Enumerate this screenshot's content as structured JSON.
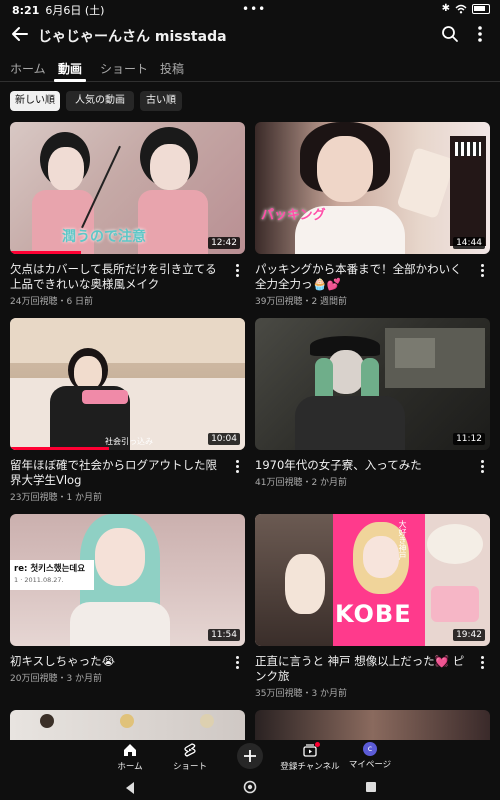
{
  "status_bar": {
    "time": "8:21",
    "date": "6月6日 (土)",
    "dots": "•••"
  },
  "header": {
    "channel_title": "じゃじゃーんさん misstada"
  },
  "tabs": [
    {
      "label": "ホーム"
    },
    {
      "label": "動画",
      "active": true
    },
    {
      "label": "ショート"
    },
    {
      "label": "投稿"
    }
  ],
  "chips": [
    {
      "label": "新しい順",
      "active": true
    },
    {
      "label": "人気の動画"
    },
    {
      "label": "古い順"
    }
  ],
  "videos": [
    {
      "title": "欠点はカバーして長所だけを引き立てる上品できれいな奥様風メイク",
      "meta": "24万回視聴・6 日前",
      "duration": "12:42",
      "watched_fraction": 0.3
    },
    {
      "title": "パッキングから本番まで！全部かわいく全力全力っ🧁💕",
      "meta": "39万回視聴・2 週間前",
      "duration": "14:44"
    },
    {
      "title": "留年ほぼ確で社会からログアウトした限界大学生Vlog",
      "meta": "23万回視聴・1 か月前",
      "duration": "10:04",
      "watched_fraction": 0.42
    },
    {
      "title": "1970年代の女子寮、入ってみた",
      "meta": "41万回視聴・2 か月前",
      "duration": "11:12"
    },
    {
      "title": "初キスしちゃった😭",
      "meta": "20万回視聴・3 か月前",
      "duration": "11:54"
    },
    {
      "title": "正直に言うと 神戸 想像以上だった💓 ピンク旅",
      "meta": "35万回視聴・3 か月前",
      "duration": "19:42"
    }
  ],
  "thumb_overlays": {
    "v1": "潤うので注意",
    "v2": "パッキング",
    "v3": "社会引っ込み",
    "v5_card_title": "re: 첫키스했는데요",
    "v5_card_sub": "1 · 2011.08.27.",
    "v6_kobe": "KOBE",
    "v6_side": "大好き神戸"
  },
  "bottom_nav": [
    {
      "label": "ホーム",
      "icon": "home-icon",
      "active": true
    },
    {
      "label": "ショート",
      "icon": "shorts-icon"
    },
    {
      "label": "",
      "icon": "create-icon"
    },
    {
      "label": "登録チャンネル",
      "icon": "subscriptions-icon"
    },
    {
      "label": "マイページ",
      "icon": "avatar-icon",
      "avatar_letter": "c"
    }
  ],
  "colors": {
    "background": "#0f0f0f",
    "accent_red": "#ff0033",
    "chip_bg": "#272727",
    "text_secondary": "#aaaaaa"
  }
}
